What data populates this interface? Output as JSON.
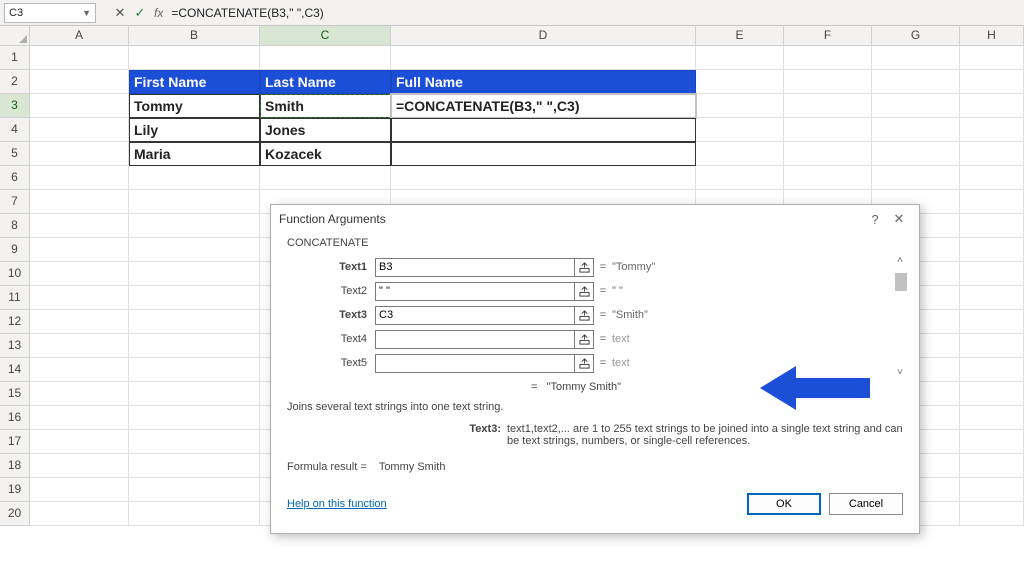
{
  "namebox": "C3",
  "formula_bar": "=CONCATENATE(B3,\" \",C3)",
  "columns": [
    "A",
    "B",
    "C",
    "D",
    "E",
    "F",
    "G",
    "H"
  ],
  "rows": [
    "1",
    "2",
    "3",
    "4",
    "5",
    "6",
    "7",
    "8",
    "9",
    "10",
    "11",
    "12",
    "13",
    "14",
    "15",
    "16",
    "17",
    "18",
    "19",
    "20"
  ],
  "table": {
    "headers": {
      "b": "First Name",
      "c": "Last Name",
      "d": "Full Name"
    },
    "r3": {
      "b": "Tommy",
      "c": "Smith",
      "d": "=CONCATENATE(B3,\" \",C3)"
    },
    "r4": {
      "b": "Lily",
      "c": "Jones",
      "d": ""
    },
    "r5": {
      "b": "Maria",
      "c": "Kozacek",
      "d": ""
    }
  },
  "dialog": {
    "title": "Function Arguments",
    "fn": "CONCATENATE",
    "args": [
      {
        "label": "Text1",
        "value": "B3",
        "result": "\"Tommy\"",
        "bold": true
      },
      {
        "label": "Text2",
        "value": "\" \"",
        "result": "\" \"",
        "bold": false
      },
      {
        "label": "Text3",
        "value": "C3",
        "result": "\"Smith\"",
        "bold": true
      },
      {
        "label": "Text4",
        "value": "",
        "result": "text",
        "bold": false,
        "dim": true
      },
      {
        "label": "Text5",
        "value": "",
        "result": "text",
        "bold": false,
        "dim": true
      }
    ],
    "result_preview": "=   \"Tommy Smith\"",
    "description": "Joins several text strings into one text string.",
    "arg_help_label": "Text3:",
    "arg_help_text": "text1,text2,... are 1 to 255 text strings to be joined into a single text string and can be text strings, numbers, or single-cell references.",
    "formula_result_label": "Formula result =",
    "formula_result_value": "Tommy Smith",
    "help_link": "Help on this function",
    "ok": "OK",
    "cancel": "Cancel"
  }
}
